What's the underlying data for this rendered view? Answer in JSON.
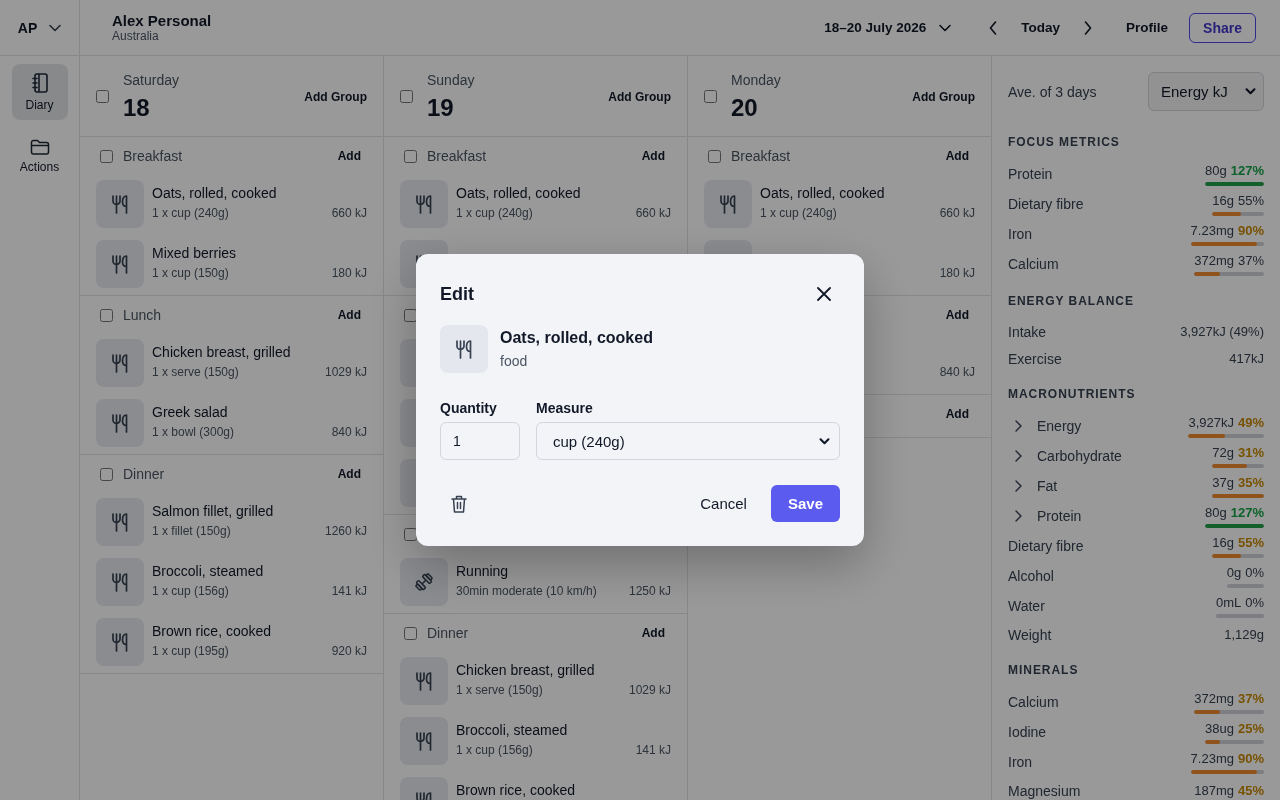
{
  "account": {
    "initials": "AP"
  },
  "header": {
    "name": "Alex Personal",
    "subtitle": "Australia",
    "date_range": "18–20 July 2026",
    "today": "Today",
    "profile": "Profile",
    "share": "Share"
  },
  "sidebar": {
    "items": [
      {
        "label": "Diary",
        "selected": true
      },
      {
        "label": "Actions",
        "selected": false
      }
    ]
  },
  "days": [
    {
      "weekday": "Saturday",
      "date": "18",
      "checked": false,
      "add_group": "Add Group",
      "groups": [
        {
          "label": "Breakfast",
          "checked": false,
          "add": "Add",
          "items": [
            {
              "kind": "food",
              "name": "Oats, rolled, cooked",
              "detail": "1 x cup (240g)",
              "energy": "660 kJ"
            },
            {
              "kind": "food",
              "name": "Mixed berries",
              "detail": "1 x cup (150g)",
              "energy": "180 kJ"
            }
          ]
        },
        {
          "label": "Lunch",
          "checked": false,
          "add": "Add",
          "items": [
            {
              "kind": "food",
              "name": "Chicken breast, grilled",
              "detail": "1 x serve (150g)",
              "energy": "1029 kJ"
            },
            {
              "kind": "food",
              "name": "Greek salad",
              "detail": "1 x bowl (300g)",
              "energy": "840 kJ"
            }
          ]
        },
        {
          "label": "Dinner",
          "checked": false,
          "add": "Add",
          "items": [
            {
              "kind": "food",
              "name": "Salmon fillet, grilled",
              "detail": "1 x fillet (150g)",
              "energy": "1260 kJ"
            },
            {
              "kind": "food",
              "name": "Broccoli, steamed",
              "detail": "1 x cup (156g)",
              "energy": "141 kJ"
            },
            {
              "kind": "food",
              "name": "Brown rice, cooked",
              "detail": "1 x cup (195g)",
              "energy": "920 kJ"
            }
          ]
        }
      ]
    },
    {
      "weekday": "Sunday",
      "date": "19",
      "checked": false,
      "add_group": "Add Group",
      "groups": [
        {
          "label": "Breakfast",
          "checked": false,
          "add": "Add",
          "items": [
            {
              "kind": "food",
              "name": "Oats, rolled, cooked",
              "detail": "1 x cup (240g)",
              "energy": "660 kJ"
            },
            {
              "kind": "food"
            }
          ]
        },
        {
          "checked": false,
          "items": [
            {
              "kind": "food"
            },
            {
              "kind": "food"
            },
            {
              "kind": "food"
            }
          ]
        },
        {
          "checked": false,
          "items": [
            {
              "kind": "exercise",
              "name": "Running",
              "detail": "30min moderate (10 km/h)",
              "energy": "1250 kJ"
            }
          ]
        },
        {
          "label": "Dinner",
          "checked": false,
          "add": "Add",
          "items": [
            {
              "kind": "food",
              "name": "Chicken breast, grilled",
              "detail": "1 x serve (150g)",
              "energy": "1029 kJ"
            },
            {
              "kind": "food",
              "name": "Broccoli, steamed",
              "detail": "1 x cup (156g)",
              "energy": "141 kJ"
            },
            {
              "kind": "food",
              "name": "Brown rice, cooked"
            }
          ]
        }
      ]
    },
    {
      "weekday": "Monday",
      "date": "20",
      "checked": false,
      "add_group": "Add Group",
      "groups": [
        {
          "label": "Breakfast",
          "checked": false,
          "add": "Add",
          "items": [
            {
              "kind": "food",
              "name": "Oats, rolled, cooked",
              "detail": "1 x cup (240g)",
              "energy": "660 kJ"
            },
            {
              "kind": "food",
              "energy": "180 kJ"
            }
          ]
        },
        {
          "add": "Add",
          "items": [
            {
              "energy": "840 kJ"
            }
          ]
        },
        {
          "add": "Add"
        }
      ]
    }
  ],
  "summary": {
    "period": "Ave. of 3 days",
    "metric": "Energy kJ",
    "sections": [
      {
        "title": "FOCUS METRICS",
        "rows": [
          {
            "label": "Protein",
            "amount": "80g",
            "percent": "127%",
            "highlighted": true,
            "met": true,
            "level": 1
          },
          {
            "label": "Dietary fibre",
            "amount": "16g",
            "percent": "55%",
            "highlighted": false,
            "met": false,
            "level": 0.55
          },
          {
            "label": "Iron",
            "amount": "7.23mg",
            "percent": "90%",
            "highlighted": true,
            "met": false,
            "level": 0.9
          },
          {
            "label": "Calcium",
            "amount": "372mg",
            "percent": "37%",
            "highlighted": false,
            "met": false,
            "level": 0.37
          }
        ]
      },
      {
        "title": "ENERGY BALANCE",
        "rows": [
          {
            "label": "Intake",
            "amount": "3,927kJ (49%)"
          },
          {
            "label": "Exercise",
            "amount": "417kJ"
          }
        ]
      },
      {
        "title": "MACRONUTRIENTS",
        "rows": [
          {
            "label": "Energy",
            "expanded": false,
            "amount": "3,927kJ",
            "percent": "49%",
            "highlighted": true,
            "met": false,
            "level": 0.49
          },
          {
            "label": "Carbohydrate",
            "expanded": false,
            "amount": "72g",
            "percent": "31%",
            "highlighted": true,
            "met": false,
            "level": 0.68
          },
          {
            "label": "Fat",
            "expanded": false,
            "amount": "37g",
            "percent": "35%",
            "highlighted": true,
            "met": false,
            "level": 1
          },
          {
            "label": "Protein",
            "expanded": false,
            "amount": "80g",
            "percent": "127%",
            "highlighted": true,
            "met": true,
            "level": 1
          },
          {
            "label": "Dietary fibre",
            "amount": "16g",
            "percent": "55%",
            "highlighted": true,
            "met": false,
            "level": 0.55
          },
          {
            "label": "Alcohol",
            "amount": "0g",
            "percent": "0%",
            "highlighted": false,
            "level": 0
          },
          {
            "label": "Water",
            "amount": "0mL",
            "percent": "0%",
            "highlighted": false,
            "level": 0
          },
          {
            "label": "Weight",
            "amount": "1,129g"
          }
        ]
      },
      {
        "title": "MINERALS",
        "rows": [
          {
            "label": "Calcium",
            "amount": "372mg",
            "percent": "37%",
            "highlighted": true,
            "met": false,
            "level": 0.37
          },
          {
            "label": "Iodine",
            "amount": "38ug",
            "percent": "25%",
            "highlighted": true,
            "met": false,
            "level": 0.25
          },
          {
            "label": "Iron",
            "amount": "7.23mg",
            "percent": "90%",
            "highlighted": true,
            "met": false,
            "level": 0.9
          },
          {
            "label": "Magnesium",
            "amount": "187mg",
            "percent": "45%",
            "highlighted": true,
            "met": false
          }
        ]
      }
    ]
  },
  "modal": {
    "title": "Edit",
    "item": {
      "kind": "food",
      "name": "Oats, rolled, cooked",
      "category": "food"
    },
    "quantity_label": "Quantity",
    "quantity": "1",
    "measure_label": "Measure",
    "measure": "cup (240g)",
    "cancel": "Cancel",
    "save": "Save"
  }
}
